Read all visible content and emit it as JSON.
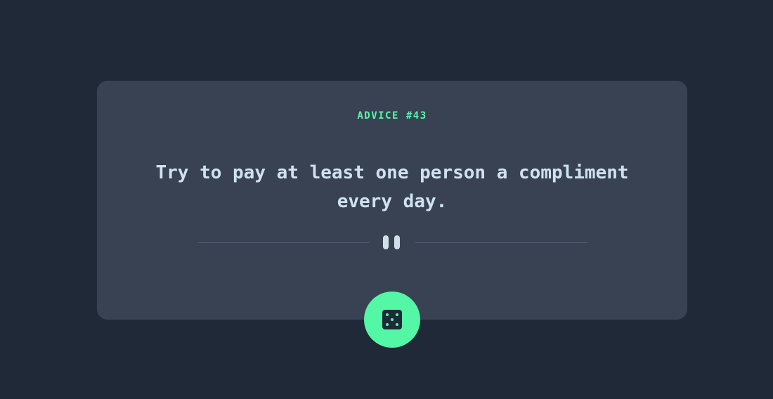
{
  "card": {
    "label": "ADVICE #43",
    "quote": "Try to pay at least one person a compliment every day."
  },
  "icons": {
    "divider": "pause-icon",
    "button": "dice-icon"
  },
  "colors": {
    "background": "#202938",
    "card": "#394253",
    "accent": "#53f7a6",
    "text": "#cfe2f0",
    "divider": "#4f5d73"
  }
}
